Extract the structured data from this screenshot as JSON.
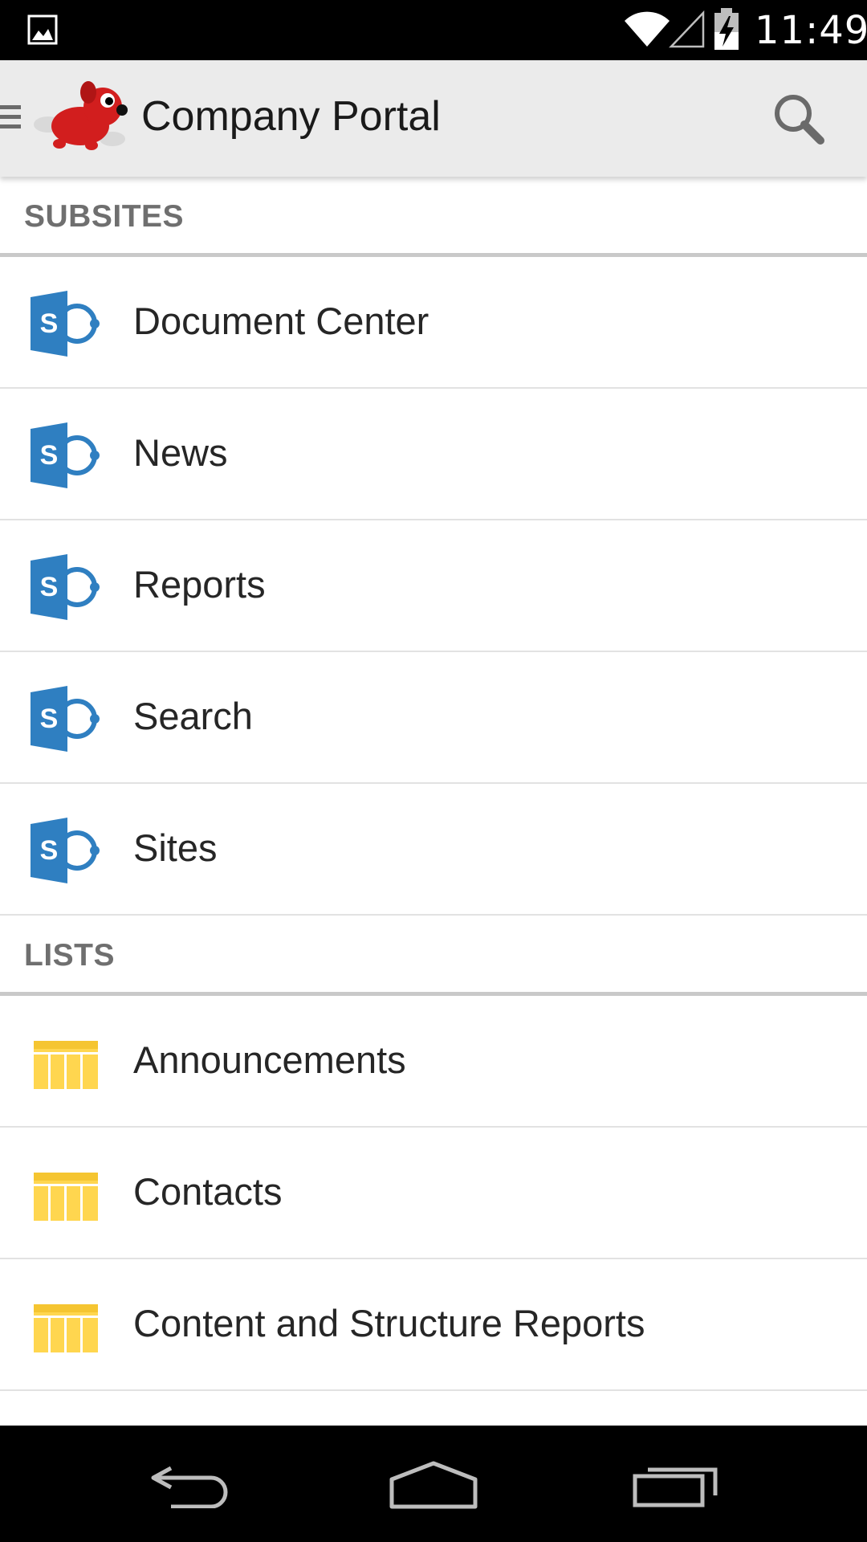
{
  "status_bar": {
    "time": "11:49",
    "icons": [
      "gallery-icon",
      "wifi-icon",
      "signal-icon",
      "battery-charging-icon"
    ]
  },
  "action_bar": {
    "title": "Company Portal",
    "icons": [
      "drawer-icon",
      "app-logo-dog",
      "search-icon"
    ]
  },
  "sections": {
    "subsites": {
      "header": "SUBSITES",
      "icon": "sharepoint-site-icon",
      "items": [
        {
          "label": "Document Center"
        },
        {
          "label": "News"
        },
        {
          "label": "Reports"
        },
        {
          "label": "Search"
        },
        {
          "label": "Sites"
        }
      ]
    },
    "lists": {
      "header": "LISTS",
      "icon": "list-table-icon",
      "items": [
        {
          "label": "Announcements"
        },
        {
          "label": "Contacts"
        },
        {
          "label": "Content and Structure Reports"
        }
      ]
    }
  },
  "nav_bar": {
    "icons": [
      "back-icon",
      "home-icon",
      "recents-icon"
    ]
  },
  "colors": {
    "status_bar": "#000000",
    "action_bar": "#ebebeb",
    "sharepoint_blue": "#2f7fc1",
    "list_yellow": "#ffd64f",
    "section_header_text": "#6f6f6f"
  }
}
